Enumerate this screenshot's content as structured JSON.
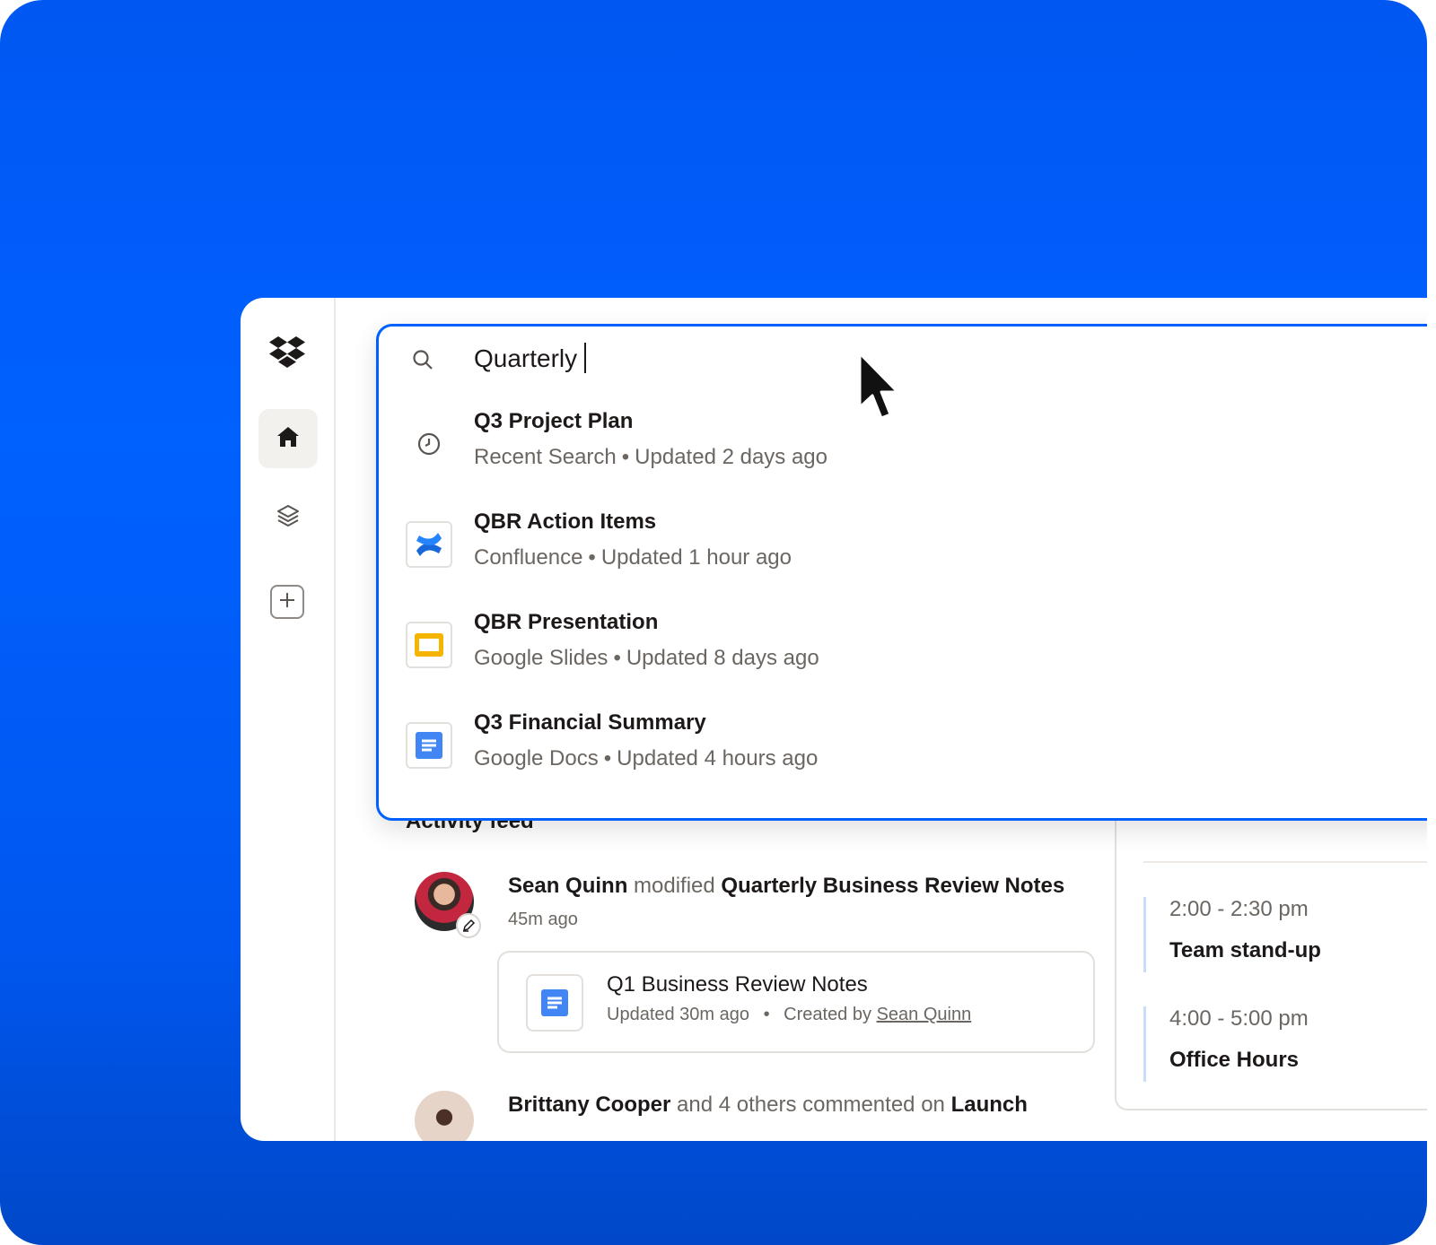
{
  "app": {
    "logo": "dropbox-logo"
  },
  "rail": {
    "items": [
      {
        "name": "home",
        "icon": "home-icon"
      },
      {
        "name": "stacks",
        "icon": "layers-icon"
      },
      {
        "name": "add",
        "icon": "plus-icon"
      }
    ]
  },
  "search": {
    "value": "Quarterly",
    "results": [
      {
        "title": "Q3 Project Plan",
        "source": "Recent Search",
        "updated": "Updated 2 days ago",
        "icon": "clock-icon"
      },
      {
        "title": "QBR Action Items",
        "source": "Confluence",
        "updated": "Updated 1 hour ago",
        "icon": "confluence-icon"
      },
      {
        "title": "QBR Presentation",
        "source": "Google Slides",
        "updated": "Updated 8 days ago",
        "icon": "google-slides-icon"
      },
      {
        "title": "Q3 Financial Summary",
        "source": "Google Docs",
        "updated": "Updated 4 hours ago",
        "icon": "google-docs-icon"
      }
    ],
    "separator": "•"
  },
  "feed": {
    "title": "Activity feed",
    "item1": {
      "actor": "Sean Quinn",
      "verb": "modified",
      "object": "Quarterly Business Review Notes",
      "time": "45m ago",
      "doc": {
        "title": "Q1 Business Review Notes",
        "updated": "Updated 30m ago",
        "separator": "•",
        "created_by_label": "Created by",
        "created_by": "Sean Quinn"
      }
    },
    "item2": {
      "actor": "Brittany Cooper",
      "verb": "and 4 others commented on",
      "object": "Launch"
    }
  },
  "calendar": {
    "events": [
      {
        "time": "2:00 - 2:30 pm",
        "name": "Team stand-up"
      },
      {
        "time": "4:00 - 5:00 pm",
        "name": "Office Hours"
      }
    ]
  },
  "colors": {
    "accent": "#0061fe",
    "background_gradient_top": "#0057f2",
    "background_gradient_bottom": "#0048c8",
    "text": "#1e1919",
    "muted_text": "#6b6661",
    "slides_yellow": "#f4b400",
    "docs_blue": "#4285f4"
  }
}
